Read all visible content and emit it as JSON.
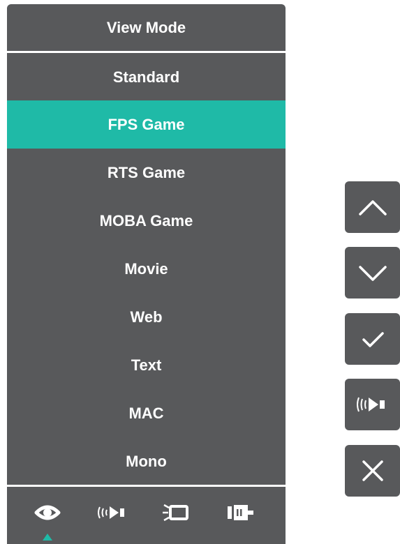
{
  "osd": {
    "title": "View Mode",
    "items": [
      {
        "label": "Standard",
        "selected": false
      },
      {
        "label": "FPS Game",
        "selected": true
      },
      {
        "label": "RTS Game",
        "selected": false
      },
      {
        "label": "MOBA Game",
        "selected": false
      },
      {
        "label": "Movie",
        "selected": false
      },
      {
        "label": "Web",
        "selected": false
      },
      {
        "label": "Text",
        "selected": false
      },
      {
        "label": "MAC",
        "selected": false
      },
      {
        "label": "Mono",
        "selected": false
      }
    ],
    "tabs": [
      {
        "icon": "eye-icon",
        "active": true
      },
      {
        "icon": "audio-icon",
        "active": false
      },
      {
        "icon": "display-icon",
        "active": false
      },
      {
        "icon": "input-icon",
        "active": false
      }
    ],
    "colors": {
      "panel": "#58595b",
      "highlight": "#1fbaa7",
      "text": "#ffffff"
    }
  },
  "keys": [
    {
      "icon": "chevron-up-icon"
    },
    {
      "icon": "chevron-down-icon"
    },
    {
      "icon": "checkmark-icon"
    },
    {
      "icon": "audio-icon"
    },
    {
      "icon": "close-icon"
    }
  ]
}
